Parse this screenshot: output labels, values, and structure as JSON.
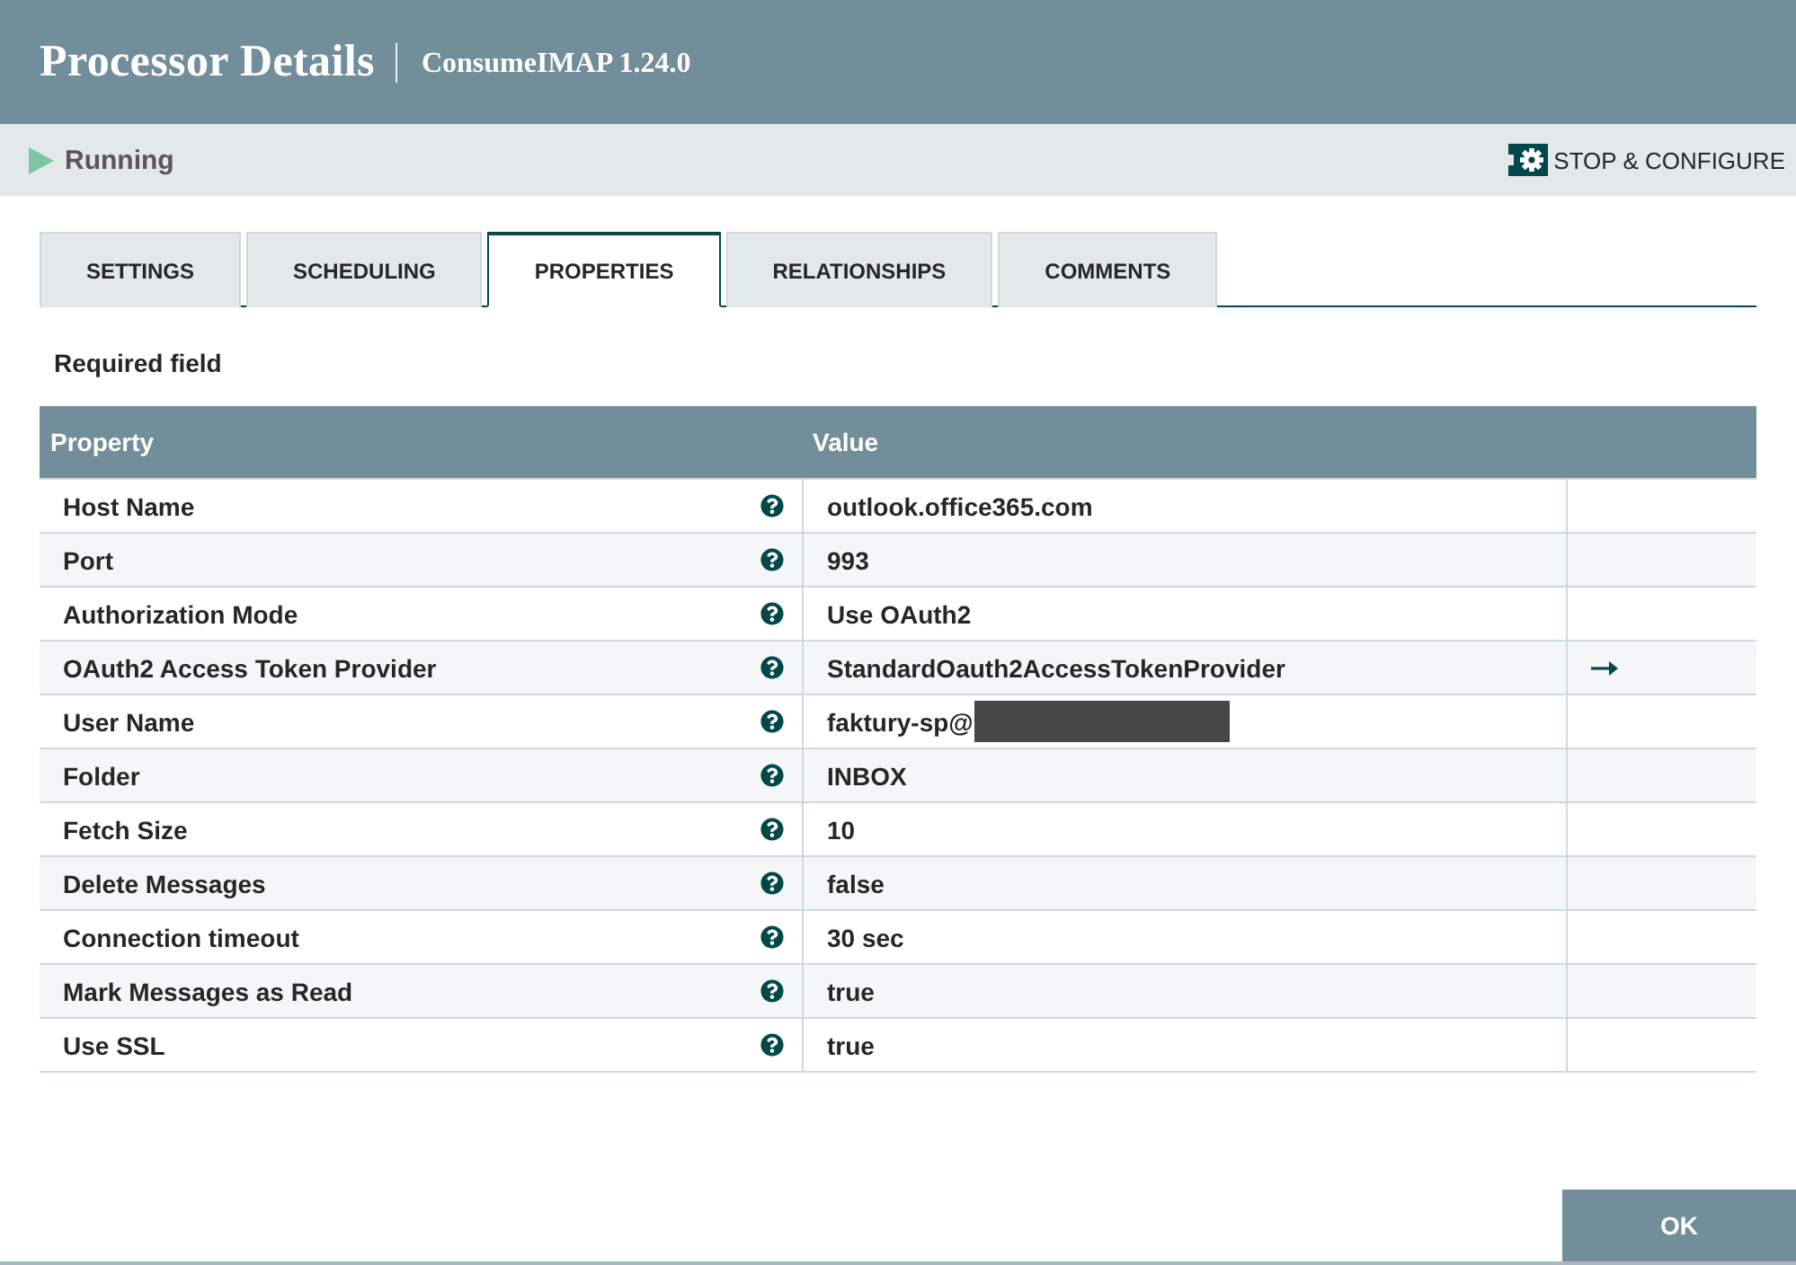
{
  "dialog": {
    "title": "Processor Details",
    "subtitle": "ConsumeIMAP 1.24.0"
  },
  "status": {
    "running": true,
    "label": "Running"
  },
  "stop_button": {
    "label": "STOP & CONFIGURE"
  },
  "tabs": [
    {
      "label": "SETTINGS",
      "selected": false
    },
    {
      "label": "SCHEDULING",
      "selected": false
    },
    {
      "label": "PROPERTIES",
      "selected": true
    },
    {
      "label": "RELATIONSHIPS",
      "selected": false
    },
    {
      "label": "COMMENTS",
      "selected": false
    }
  ],
  "required_note": "Required field",
  "table": {
    "columns": [
      "Property",
      "Value"
    ],
    "rows": [
      {
        "property": "Host Name",
        "value": "outlook.office365.com",
        "go_to": false,
        "redacted": false
      },
      {
        "property": "Port",
        "value": "993",
        "go_to": false,
        "redacted": false
      },
      {
        "property": "Authorization Mode",
        "value": "Use OAuth2",
        "go_to": false,
        "redacted": false
      },
      {
        "property": "OAuth2 Access Token Provider",
        "value": "StandardOauth2AccessTokenProvider",
        "go_to": true,
        "redacted": false
      },
      {
        "property": "User Name",
        "value": "faktury-sp@",
        "go_to": false,
        "redacted": true
      },
      {
        "property": "Folder",
        "value": "INBOX",
        "go_to": false,
        "redacted": false
      },
      {
        "property": "Fetch Size",
        "value": "10",
        "go_to": false,
        "redacted": false
      },
      {
        "property": "Delete Messages",
        "value": "false",
        "go_to": false,
        "redacted": false
      },
      {
        "property": "Connection timeout",
        "value": "30 sec",
        "go_to": false,
        "redacted": false
      },
      {
        "property": "Mark Messages as Read",
        "value": "true",
        "go_to": false,
        "redacted": false
      },
      {
        "property": "Use SSL",
        "value": "true",
        "go_to": false,
        "redacted": false
      }
    ]
  },
  "ok_button": {
    "label": "OK"
  }
}
